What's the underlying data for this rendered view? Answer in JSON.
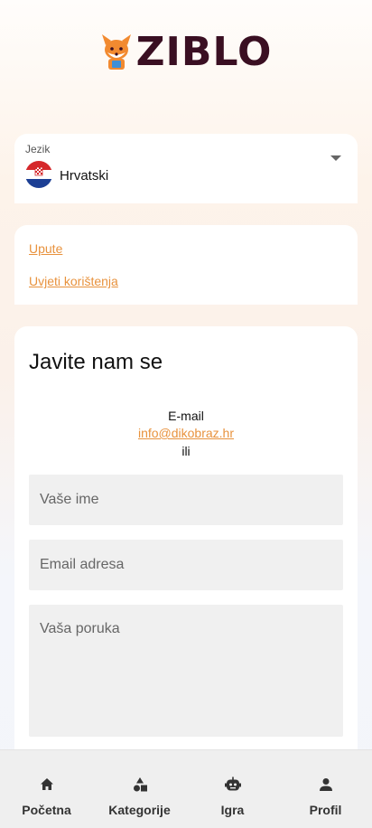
{
  "brand": {
    "name": "ZIBLO",
    "color": "#3a0f22",
    "accent": "#e8923d"
  },
  "language": {
    "label": "Jezik",
    "value": "Hrvatski",
    "flag_icon": "croatia-flag-icon"
  },
  "links": [
    {
      "label": "Upute"
    },
    {
      "label": "Uvjeti korištenja"
    }
  ],
  "contact": {
    "title": "Javite nam se",
    "email_label": "E-mail",
    "email": "info@dikobraz.hr",
    "or_label": "ili",
    "name_placeholder": "Vaše ime",
    "email_placeholder": "Email adresa",
    "message_placeholder": "Vaša poruka"
  },
  "nav": [
    {
      "label": "Početna",
      "icon": "home-icon"
    },
    {
      "label": "Kategorije",
      "icon": "shapes-icon"
    },
    {
      "label": "Igra",
      "icon": "robot-icon"
    },
    {
      "label": "Profil",
      "icon": "person-icon"
    }
  ]
}
